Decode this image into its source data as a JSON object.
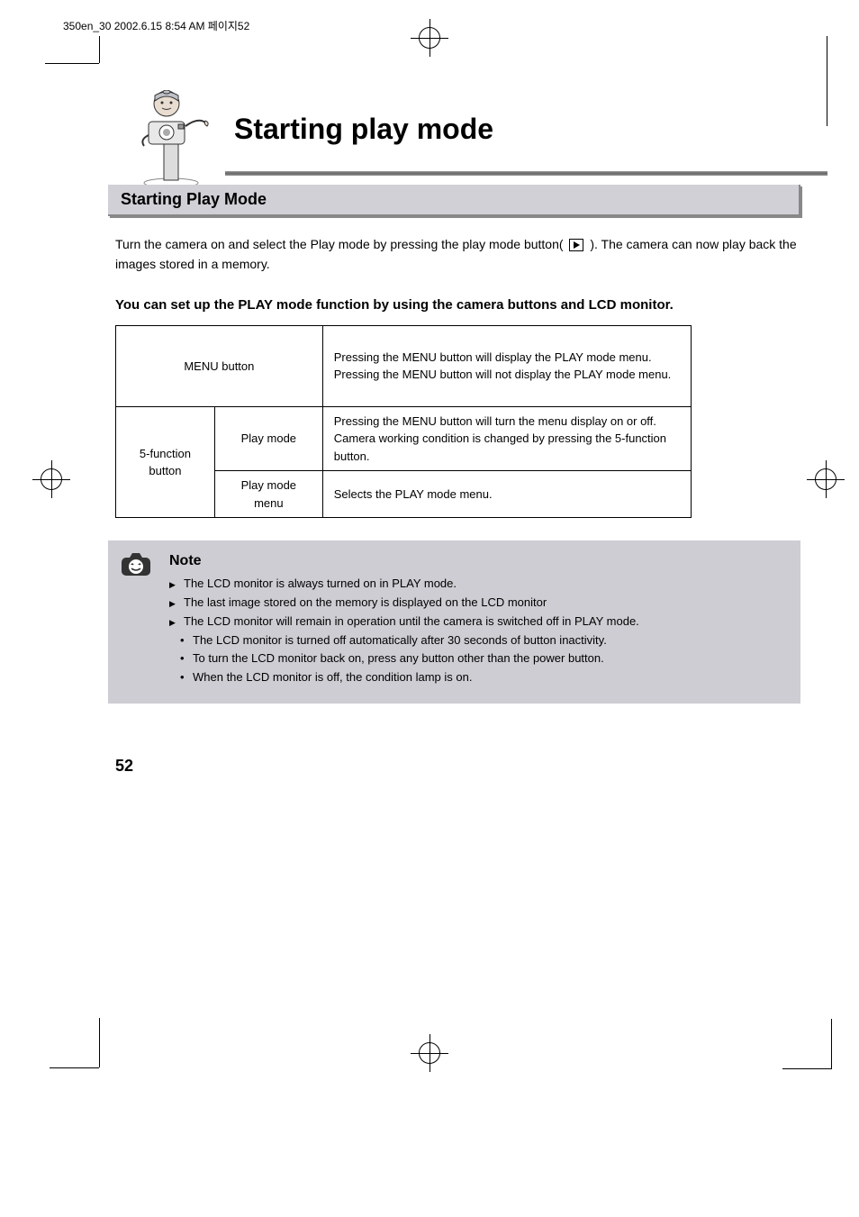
{
  "header_marker": "350en_30  2002.6.15 8:54 AM  페이지52",
  "page_title": "Starting play mode",
  "section_heading": "Starting Play Mode",
  "intro_prefix": "Turn the camera on and select the Play mode by pressing the play mode button( ",
  "intro_suffix": " ). The camera can now play back the images stored in a memory.",
  "subheading": "You can set up the PLAY mode function by using the camera buttons and LCD monitor.",
  "table": {
    "r1c1": "MENU button",
    "r1c2_line1": "Pressing the MENU button will display the PLAY mode menu.",
    "r1c2_line2": "Pressing the MENU button will not display the PLAY mode menu.",
    "r2c1": "5-function button",
    "r2c2a": "Play mode",
    "r2c2b_line1": "Pressing the MENU button will turn the menu display on or off.",
    "r2c2b_line2": "Camera working condition is changed by pressing the 5-function button.",
    "r2c3a": "Play mode menu",
    "r2c3b": "Selects the PLAY mode menu."
  },
  "note": {
    "heading": "Note",
    "items": [
      "The LCD monitor is always turned on in PLAY mode.",
      "The last image stored on the memory is displayed on the LCD monitor",
      "The LCD monitor will remain in operation until the camera is switched off in PLAY mode."
    ],
    "subitems": [
      "The LCD monitor is turned off automatically after 30 seconds of button inactivity.",
      "To turn the LCD monitor back on, press any button other than the power button.",
      "When the LCD monitor is off, the condition lamp is on."
    ]
  },
  "page_number": "52"
}
